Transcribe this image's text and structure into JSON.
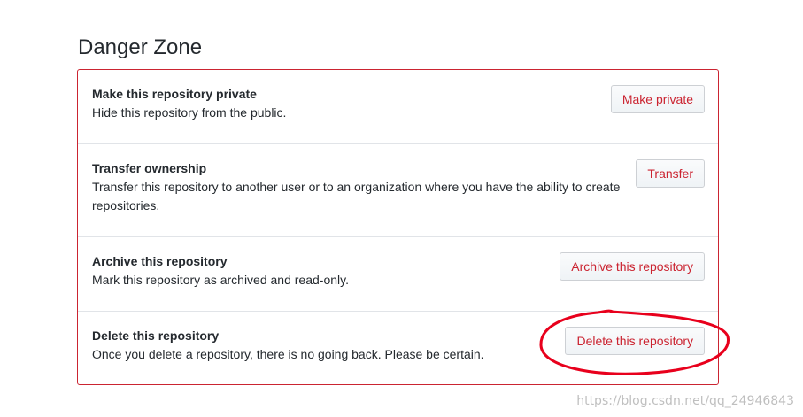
{
  "page": {
    "heading": "Danger Zone",
    "watermark": "https://blog.csdn.net/qq_24946843"
  },
  "rows": [
    {
      "title": "Make this repository private",
      "description": "Hide this repository from the public.",
      "button": "Make private"
    },
    {
      "title": "Transfer ownership",
      "description": "Transfer this repository to another user or to an organization where you have the ability to create repositories.",
      "button": "Transfer"
    },
    {
      "title": "Archive this repository",
      "description": "Mark this repository as archived and read-only.",
      "button": "Archive this repository"
    },
    {
      "title": "Delete this repository",
      "description": "Once you delete a repository, there is no going back. Please be certain.",
      "button": "Delete this repository"
    }
  ],
  "colors": {
    "danger": "#cb2431",
    "annotation": "#e8001c"
  }
}
